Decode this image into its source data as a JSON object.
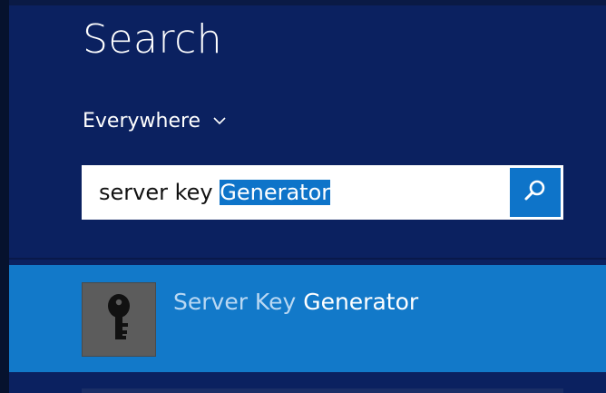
{
  "title": "Search",
  "scope": {
    "label": "Everywhere"
  },
  "search": {
    "typed_text": "server key ",
    "autocomplete_text": "Generator"
  },
  "results": [
    {
      "label_match": "Server Key ",
      "label_rest": "Generator",
      "icon": "key-icon"
    }
  ],
  "colors": {
    "background": "#0b2160",
    "accent": "#0e74c9",
    "result_highlight": "#1279c9",
    "icon_tile": "#5c5c5c"
  },
  "icons": {
    "scope_dropdown": "chevron-down-icon",
    "search_button": "magnifier-icon"
  }
}
